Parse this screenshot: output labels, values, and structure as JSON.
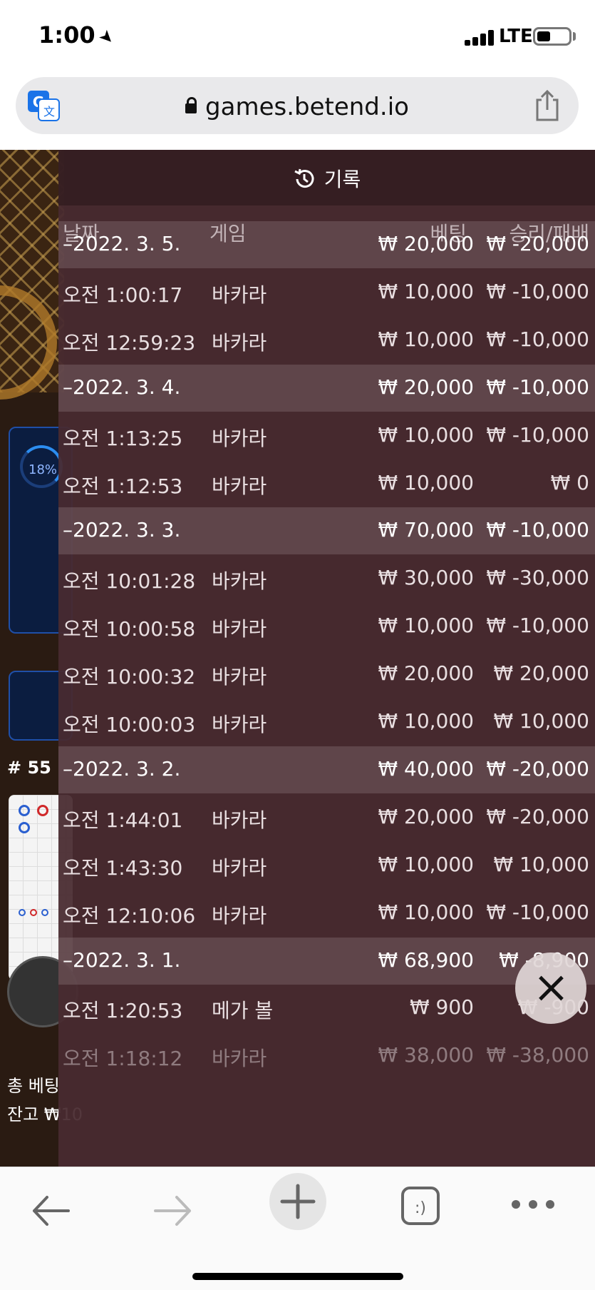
{
  "status_bar": {
    "time": "1:00",
    "network": "LTE"
  },
  "browser": {
    "url": "games.betend.io"
  },
  "game": {
    "percent": "18%",
    "round": "# 55",
    "total_bet_label": "총 베팅",
    "balance_label": "잔고 ₩10"
  },
  "history": {
    "title": "기록",
    "columns": {
      "date": "날짜",
      "game": "게임",
      "bet": "베팅",
      "win_loss": "승리/패배"
    },
    "rows": [
      {
        "type": "date",
        "date": "–2022. 3. 5.",
        "game": "",
        "bet": "₩ 20,000",
        "win_loss": "₩ -20,000"
      },
      {
        "type": "entry",
        "date": "오전 1:00:17",
        "game": "바카라",
        "bet": "₩ 10,000",
        "win_loss": "₩ -10,000"
      },
      {
        "type": "entry",
        "date": "오전 12:59:23",
        "game": "바카라",
        "bet": "₩ 10,000",
        "win_loss": "₩ -10,000"
      },
      {
        "type": "date",
        "date": "–2022. 3. 4.",
        "game": "",
        "bet": "₩ 20,000",
        "win_loss": "₩ -10,000"
      },
      {
        "type": "entry",
        "date": "오전 1:13:25",
        "game": "바카라",
        "bet": "₩ 10,000",
        "win_loss": "₩ -10,000"
      },
      {
        "type": "entry",
        "date": "오전 1:12:53",
        "game": "바카라",
        "bet": "₩ 10,000",
        "win_loss": "₩ 0"
      },
      {
        "type": "date",
        "date": "–2022. 3. 3.",
        "game": "",
        "bet": "₩ 70,000",
        "win_loss": "₩ -10,000"
      },
      {
        "type": "entry",
        "date": "오전 10:01:28",
        "game": "바카라",
        "bet": "₩ 30,000",
        "win_loss": "₩ -30,000"
      },
      {
        "type": "entry",
        "date": "오전 10:00:58",
        "game": "바카라",
        "bet": "₩ 10,000",
        "win_loss": "₩ -10,000"
      },
      {
        "type": "entry",
        "date": "오전 10:00:32",
        "game": "바카라",
        "bet": "₩ 20,000",
        "win_loss": "₩ 20,000"
      },
      {
        "type": "entry",
        "date": "오전 10:00:03",
        "game": "바카라",
        "bet": "₩ 10,000",
        "win_loss": "₩ 10,000"
      },
      {
        "type": "date",
        "date": "–2022. 3. 2.",
        "game": "",
        "bet": "₩ 40,000",
        "win_loss": "₩ -20,000"
      },
      {
        "type": "entry",
        "date": "오전 1:44:01",
        "game": "바카라",
        "bet": "₩ 20,000",
        "win_loss": "₩ -20,000"
      },
      {
        "type": "entry",
        "date": "오전 1:43:30",
        "game": "바카라",
        "bet": "₩ 10,000",
        "win_loss": "₩ 10,000"
      },
      {
        "type": "entry",
        "date": "오전 12:10:06",
        "game": "바카라",
        "bet": "₩ 10,000",
        "win_loss": "₩ -10,000"
      },
      {
        "type": "date",
        "date": "–2022. 3. 1.",
        "game": "",
        "bet": "₩ 68,900",
        "win_loss": "₩ -8,900"
      },
      {
        "type": "entry",
        "date": "오전 1:20:53",
        "game": "메가 볼",
        "bet": "₩ 900",
        "win_loss": "₩ -900"
      },
      {
        "type": "entry",
        "date": "오전 1:18:12",
        "game": "바카라",
        "bet": "₩ 38,000",
        "win_loss": "₩ -38,000"
      }
    ]
  },
  "toolbar": {
    "back_icon": "back-arrow-icon",
    "forward_icon": "forward-arrow-icon",
    "new_tab_icon": "plus-icon",
    "tabs_icon": "tabs-icon",
    "more_icon": "more-icon"
  }
}
